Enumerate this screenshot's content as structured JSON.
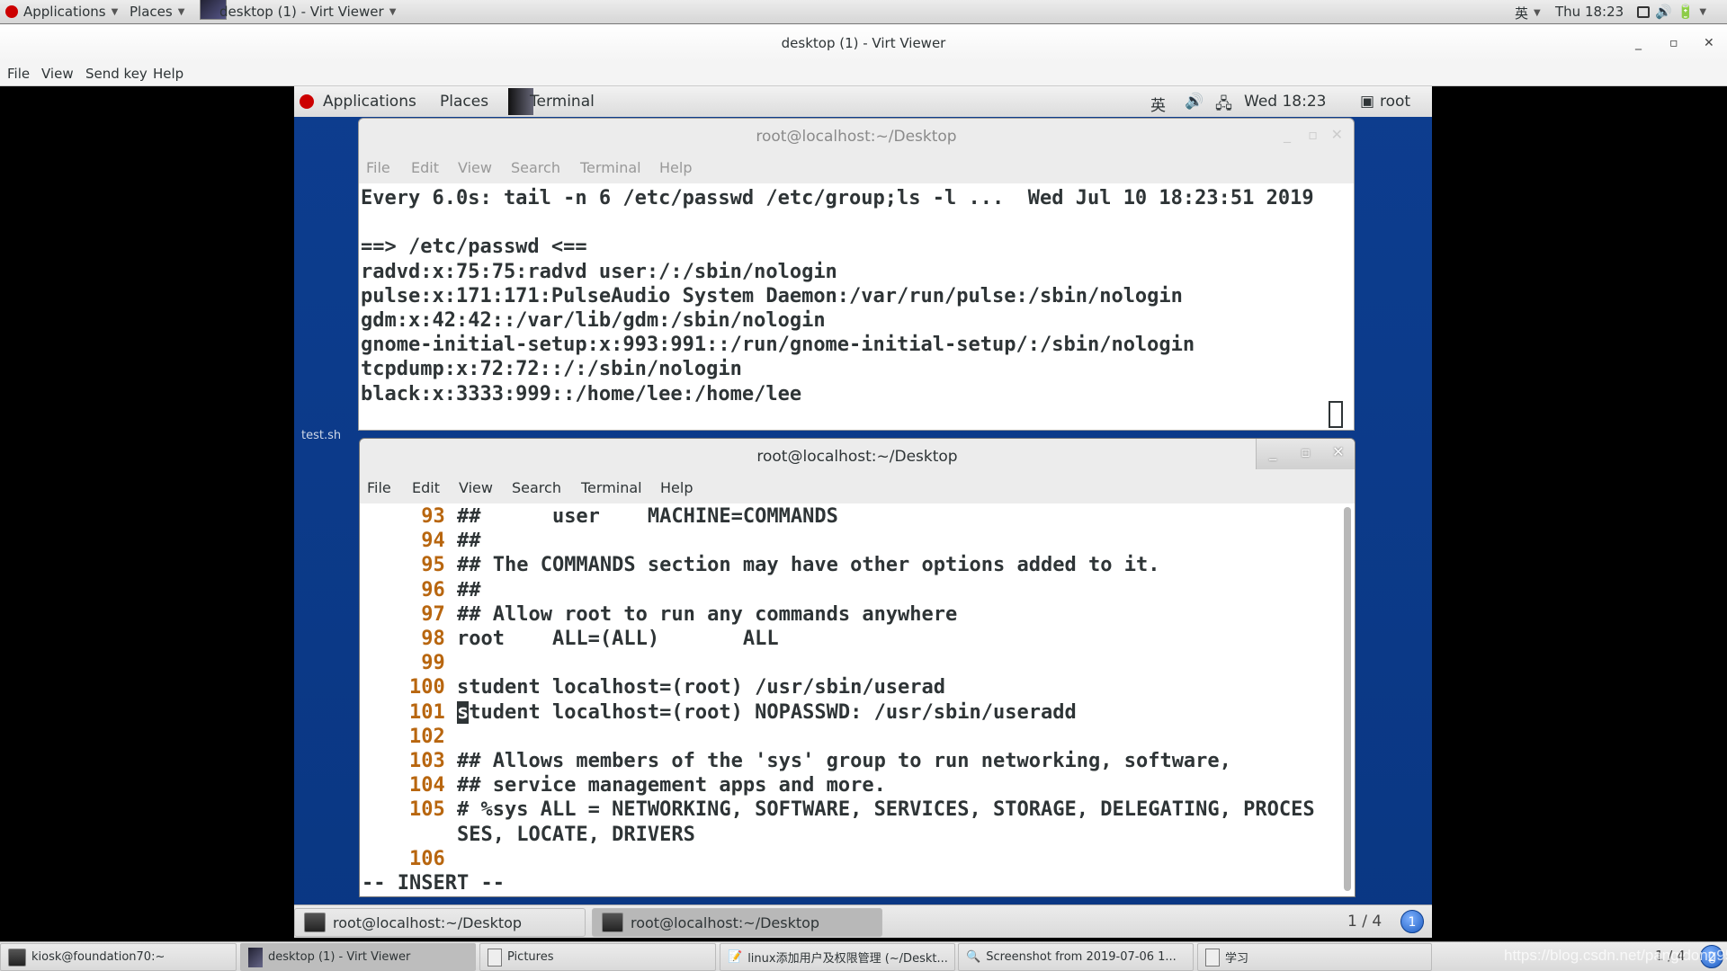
{
  "host_top": {
    "applications": "Applications",
    "places": "Places",
    "window": "desktop (1) - Virt Viewer",
    "ime": "英",
    "clock": "Thu 18:23"
  },
  "viewer": {
    "title": "desktop (1) - Virt Viewer",
    "menu": [
      "File",
      "View",
      "Send key",
      "Help"
    ]
  },
  "guest_top": {
    "applications": "Applications",
    "places": "Places",
    "window": "Terminal",
    "ime": "英",
    "clock": "Wed 18:23",
    "user": "root"
  },
  "term1": {
    "title": "root@localhost:~/Desktop",
    "menu": [
      "File",
      "Edit",
      "View",
      "Search",
      "Terminal",
      "Help"
    ],
    "lines": [
      "Every 6.0s: tail -n 6 /etc/passwd /etc/group;ls -l ...  Wed Jul 10 18:23:51 2019",
      "",
      "==> /etc/passwd <==",
      "radvd:x:75:75:radvd user:/:/sbin/nologin",
      "pulse:x:171:171:PulseAudio System Daemon:/var/run/pulse:/sbin/nologin",
      "gdm:x:42:42::/var/lib/gdm:/sbin/nologin",
      "gnome-initial-setup:x:993:991::/run/gnome-initial-setup/:/sbin/nologin",
      "tcpdump:x:72:72::/:/sbin/nologin",
      "black:x:3333:999::/home/lee:/home/lee"
    ]
  },
  "desktop_label": "test.sh",
  "term2": {
    "title": "root@localhost:~/Desktop",
    "menu": [
      "File",
      "Edit",
      "View",
      "Search",
      "Terminal",
      "Help"
    ],
    "lines": [
      {
        "num": "93",
        "text": "##      user    MACHINE=COMMANDS"
      },
      {
        "num": "94",
        "text": "##"
      },
      {
        "num": "95",
        "text": "## The COMMANDS section may have other options added to it."
      },
      {
        "num": "96",
        "text": "##"
      },
      {
        "num": "97",
        "text": "## Allow root to run any commands anywhere"
      },
      {
        "num": "98",
        "text": "root    ALL=(ALL)       ALL"
      },
      {
        "num": "99",
        "text": ""
      },
      {
        "num": "100",
        "text": "student localhost=(root) /usr/sbin/userad"
      },
      {
        "num": "101",
        "text": "student localhost=(root) NOPASSWD: /usr/sbin/useradd"
      },
      {
        "num": "102",
        "text": ""
      },
      {
        "num": "103",
        "text": "## Allows members of the 'sys' group to run networking, software,"
      },
      {
        "num": "104",
        "text": "## service management apps and more."
      },
      {
        "num": "105",
        "text": "# %sys ALL = NETWORKING, SOFTWARE, SERVICES, STORAGE, DELEGATING, PROCES"
      },
      {
        "num": "",
        "text": "SES, LOCATE, DRIVERS"
      },
      {
        "num": "106",
        "text": ""
      }
    ],
    "status": "-- INSERT --"
  },
  "guest_taskbar": {
    "items": [
      "root@localhost:~/Desktop",
      "root@localhost:~/Desktop"
    ],
    "pager": "1 / 4",
    "badge": "1"
  },
  "host_taskbar": {
    "items": [
      "kiosk@foundation70:~",
      "desktop (1) - Virt Viewer",
      "Pictures",
      "linux添加用户及权限管理 (~/Deskt...",
      "Screenshot from 2019-07-06 1...",
      "学习"
    ],
    "pager": "1 / 4",
    "badge": "2",
    "watermark": "https://blog.csdn.net/pangidong95"
  },
  "colors": {
    "guest_bg": "#0b3a88",
    "line_number": "#b8660f",
    "terminal_text": "#2e3436"
  }
}
